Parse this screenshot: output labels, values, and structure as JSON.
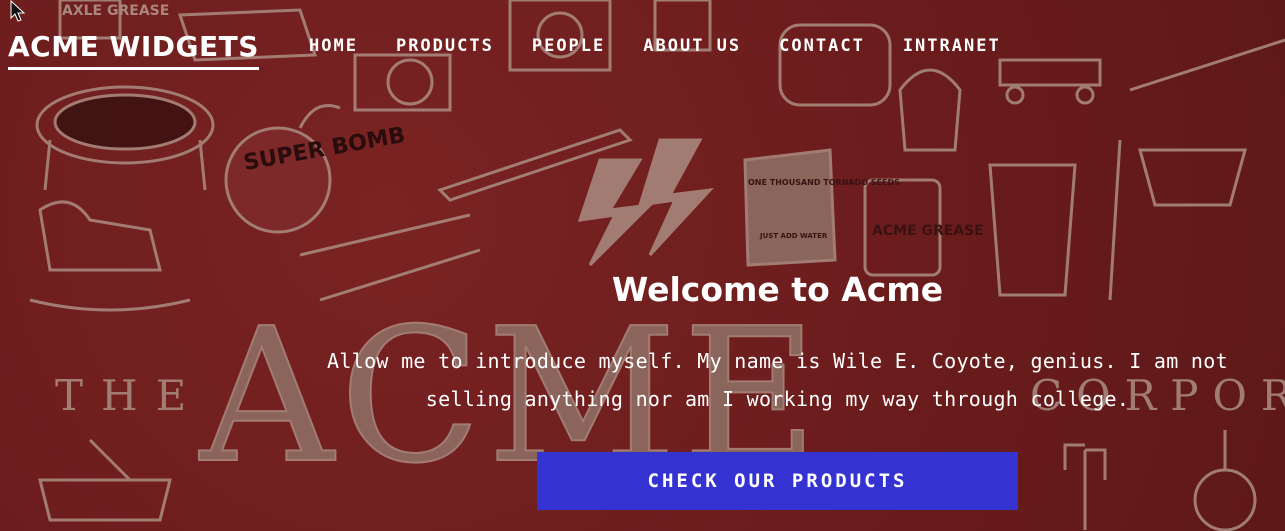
{
  "brand": {
    "name": "ACME WIDGETS"
  },
  "nav": {
    "items": [
      {
        "label": "HOME"
      },
      {
        "label": "PRODUCTS"
      },
      {
        "label": "PEOPLE"
      },
      {
        "label": "ABOUT US"
      },
      {
        "label": "CONTACT"
      },
      {
        "label": "INTRANET"
      }
    ]
  },
  "hero": {
    "background_image_text": {
      "axle_grease": "AXLE GREASE",
      "super_bomb": "SUPER BOMB",
      "tornado_seeds": "ONE THOUSAND TORNADO SEEDS",
      "just_add_water": "JUST ADD WATER",
      "acme_grease": "ACME GREASE",
      "the": "THE",
      "acme": "ACME",
      "corpor": "CORPOR"
    },
    "title": "Welcome to Acme",
    "intro": "Allow me to introduce myself. My name is Wile E. Coyote, genius. I am not selling anything nor am I working my way through college.",
    "cta_label": "CHECK OUR PRODUCTS"
  },
  "colors": {
    "background": "#6f1d1d",
    "art": "#a8877c",
    "cta": "#3432d0",
    "text": "#ffffff"
  },
  "icons": {
    "cursor": "mouse-pointer-icon"
  }
}
